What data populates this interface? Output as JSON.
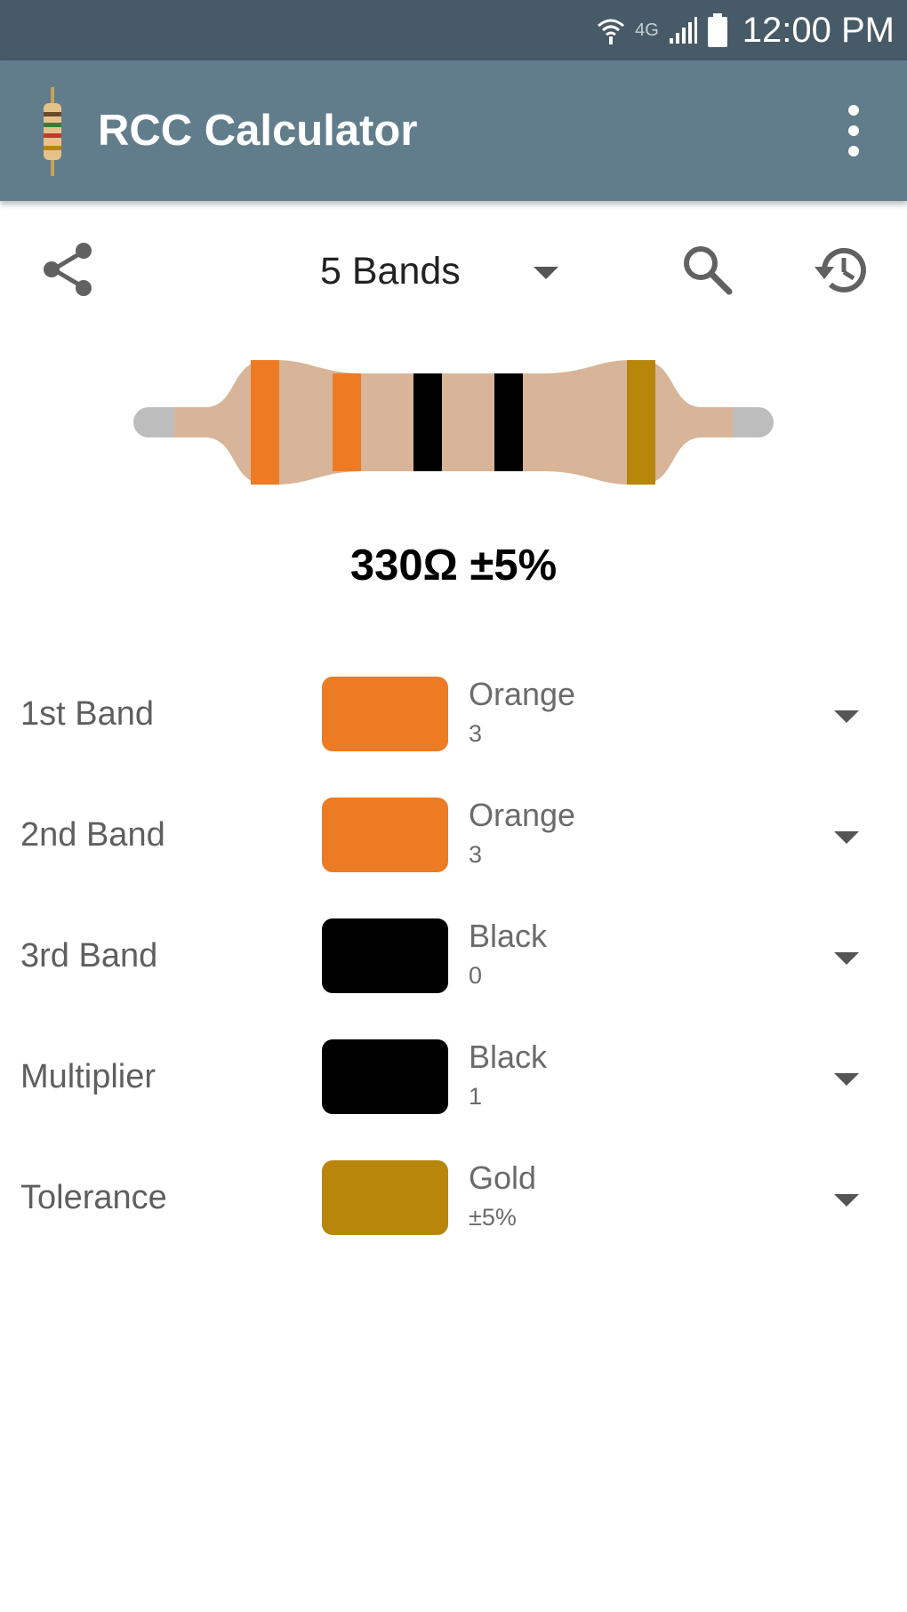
{
  "status_bar": {
    "network_label": "4G",
    "time": "12:00 PM"
  },
  "app_bar": {
    "title": "RCC Calculator",
    "menu_icon": "more-vert-icon",
    "logo_icon": "resistor-logo-icon"
  },
  "toolbar": {
    "share_icon": "share-icon",
    "band_mode": "5 Bands",
    "search_icon": "search-icon",
    "history_icon": "history-icon"
  },
  "resistor": {
    "band_colors": [
      "#ed7b24",
      "#ed7b24",
      "#000000",
      "#000000",
      "#b8860b"
    ]
  },
  "result": "330Ω ±5%",
  "bands": [
    {
      "label": "1st Band",
      "color_name": "Orange",
      "value": "3",
      "color": "#ed7b24"
    },
    {
      "label": "2nd Band",
      "color_name": "Orange",
      "value": "3",
      "color": "#ed7b24"
    },
    {
      "label": "3rd Band",
      "color_name": "Black",
      "value": "0",
      "color": "#000000"
    },
    {
      "label": "Multiplier",
      "color_name": "Black",
      "value": "1",
      "color": "#000000"
    },
    {
      "label": "Tolerance",
      "color_name": "Gold",
      "value": "±5%",
      "color": "#b8860b"
    }
  ],
  "colors": {
    "status_bar": "#475a67",
    "app_bar": "#617d8b",
    "resistor_body": "#d8b598",
    "resistor_lead": "#bdbdbd"
  }
}
